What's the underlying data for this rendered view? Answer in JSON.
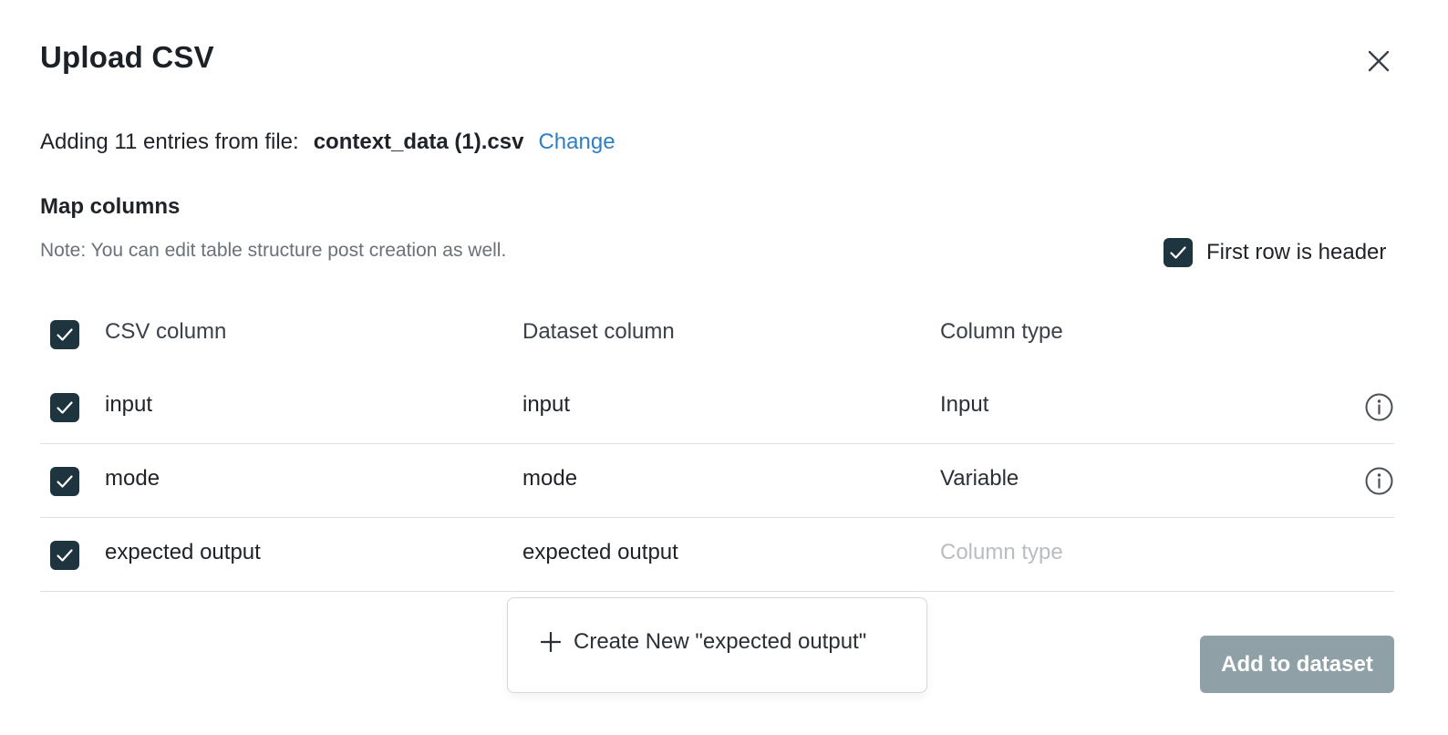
{
  "dialog": {
    "title": "Upload CSV",
    "file_prefix": "Adding 11 entries from file:",
    "file_name": "context_data (1).csv",
    "change_label": "Change",
    "section_title": "Map columns",
    "note": "Note: You can edit table structure post creation as well.",
    "first_row_header_label": "First row is header",
    "first_row_header_checked": true,
    "close_icon": "close-icon"
  },
  "table": {
    "headers": {
      "csv_column": "CSV column",
      "dataset_column": "Dataset column",
      "column_type": "Column type"
    },
    "rows": [
      {
        "checked": true,
        "csv_column": "input",
        "dataset_column": "input",
        "column_type": "Input",
        "info_icon": "info-icon"
      },
      {
        "checked": true,
        "csv_column": "mode",
        "dataset_column": "mode",
        "column_type": "Variable",
        "info_icon": "info-icon"
      },
      {
        "checked": true,
        "csv_column": "expected output",
        "dataset_column": "expected output",
        "column_type_placeholder": "Column type"
      }
    ]
  },
  "dropdown": {
    "create_new_label": "Create New \"expected output\"",
    "icon": "plus-icon"
  },
  "actions": {
    "add_label": "Add to dataset"
  },
  "colors": {
    "checkbox": "#1e3540",
    "link": "#2f7fc1",
    "primary_button_disabled": "#8fa1a7",
    "placeholder": "#b9bdc2"
  }
}
